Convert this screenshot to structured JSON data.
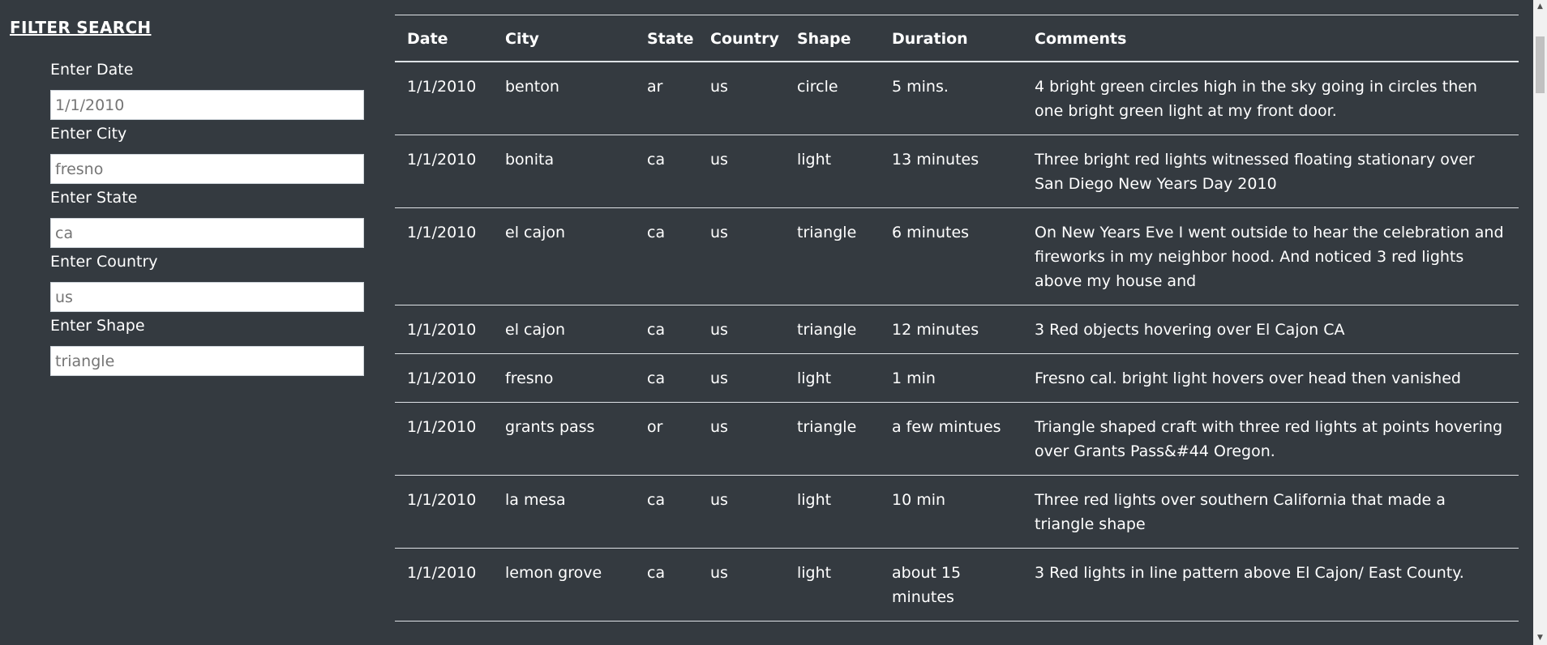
{
  "filter": {
    "title": "FILTER SEARCH",
    "fields": [
      {
        "label": "Enter Date",
        "placeholder": "1/1/2010"
      },
      {
        "label": "Enter City",
        "placeholder": "fresno"
      },
      {
        "label": "Enter State",
        "placeholder": "ca"
      },
      {
        "label": "Enter Country",
        "placeholder": "us"
      },
      {
        "label": "Enter Shape",
        "placeholder": "triangle"
      }
    ]
  },
  "table": {
    "headers": [
      "Date",
      "City",
      "State",
      "Country",
      "Shape",
      "Duration",
      "Comments"
    ],
    "rows": [
      [
        "1/1/2010",
        "benton",
        "ar",
        "us",
        "circle",
        "5 mins.",
        "4 bright green circles high in the sky going in circles then one bright green light at my front door."
      ],
      [
        "1/1/2010",
        "bonita",
        "ca",
        "us",
        "light",
        "13 minutes",
        "Three bright red lights witnessed floating stationary over San Diego New Years Day 2010"
      ],
      [
        "1/1/2010",
        "el cajon",
        "ca",
        "us",
        "triangle",
        "6 minutes",
        "On New Years Eve I went outside to hear the celebration and fireworks in my neighbor hood. And noticed 3 red lights above my house and"
      ],
      [
        "1/1/2010",
        "el cajon",
        "ca",
        "us",
        "triangle",
        "12 minutes",
        "3 Red objects hovering over El Cajon CA"
      ],
      [
        "1/1/2010",
        "fresno",
        "ca",
        "us",
        "light",
        "1 min",
        "Fresno cal. bright light hovers over head then vanished"
      ],
      [
        "1/1/2010",
        "grants pass",
        "or",
        "us",
        "triangle",
        "a few mintues",
        "Triangle shaped craft with three red lights at points hovering over Grants Pass&#44 Oregon."
      ],
      [
        "1/1/2010",
        "la mesa",
        "ca",
        "us",
        "light",
        "10 min",
        "Three red lights over southern California that made a triangle shape"
      ],
      [
        "1/1/2010",
        "lemon grove",
        "ca",
        "us",
        "light",
        "about 15 minutes",
        "3 Red lights in line pattern above El Cajon/ East County."
      ]
    ]
  },
  "scrollbar": {
    "up_icon": "scroll-up-arrow-icon",
    "down_icon": "scroll-down-arrow-icon"
  }
}
